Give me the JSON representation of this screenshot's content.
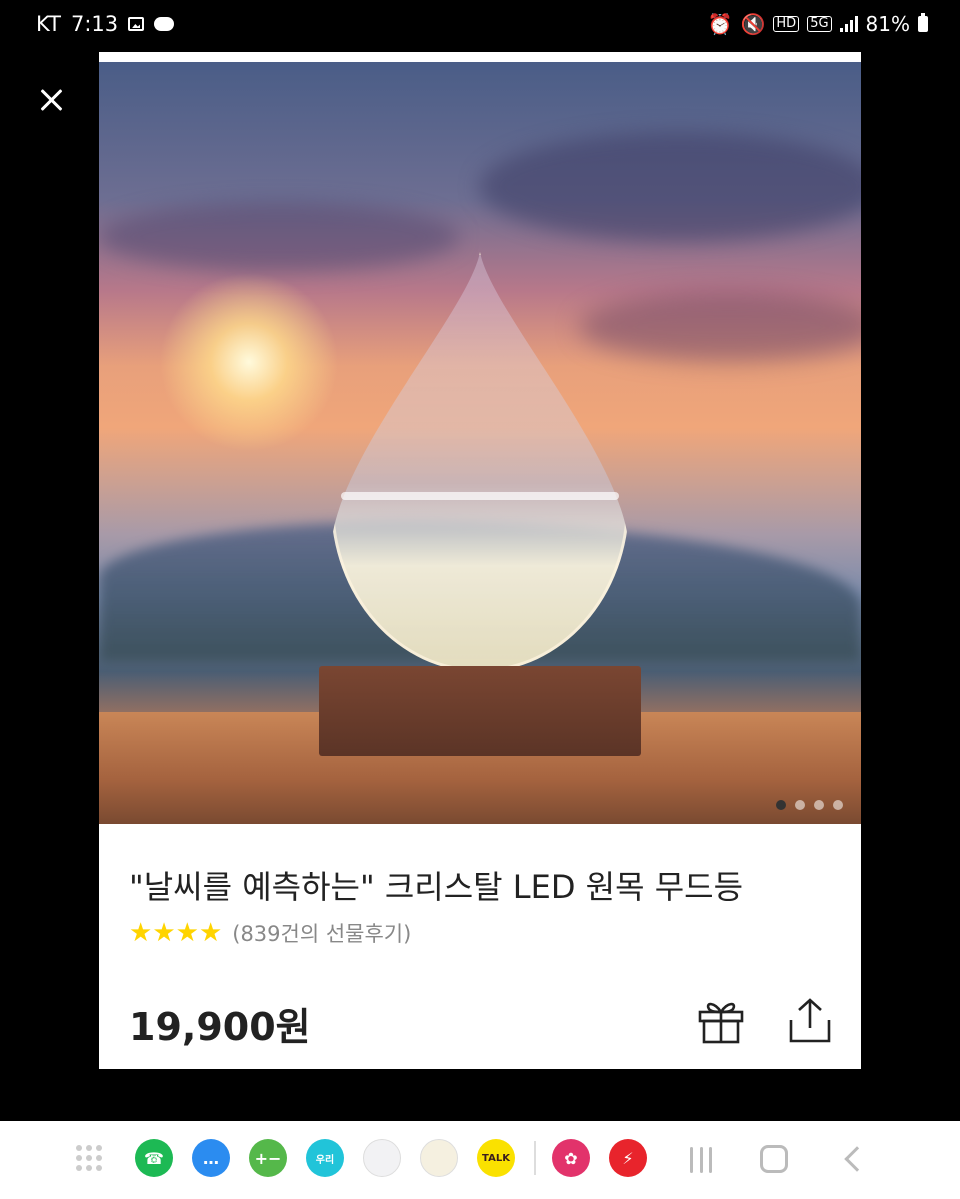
{
  "status_bar": {
    "carrier": "KT",
    "time": "7:13",
    "network": "5G",
    "hd_badge": "HD",
    "battery": "81%"
  },
  "product": {
    "title": "\"날씨를 예측하는\" 크리스탈 LED 원목 무드등",
    "rating_stars": 4,
    "review_text": "(839건의 선물후기)",
    "price": "19,900원",
    "image_count": 4,
    "current_image": 1
  },
  "icons": {
    "close": "close-icon",
    "gift": "gift-icon",
    "share": "share-icon"
  },
  "dock": {
    "apps": [
      {
        "name": "phone",
        "color": "#1db954",
        "glyph": "☎"
      },
      {
        "name": "messages",
        "color": "#2b8cf0",
        "glyph": "…"
      },
      {
        "name": "calculator",
        "color": "#55b84a",
        "glyph": "+−"
      },
      {
        "name": "woori-gs",
        "color": "#21c4d9",
        "glyph": "우리"
      },
      {
        "name": "app-folder",
        "color": "#f2f2f4",
        "glyph": ""
      },
      {
        "name": "calendar",
        "color": "#f5f0e0",
        "glyph": ""
      },
      {
        "name": "kakaotalk",
        "color": "#fae100",
        "glyph": "TALK"
      },
      {
        "name": "flower-app",
        "color": "#e2336b",
        "glyph": "✿"
      },
      {
        "name": "lightning-app",
        "color": "#e8242c",
        "glyph": "⚡"
      }
    ]
  }
}
